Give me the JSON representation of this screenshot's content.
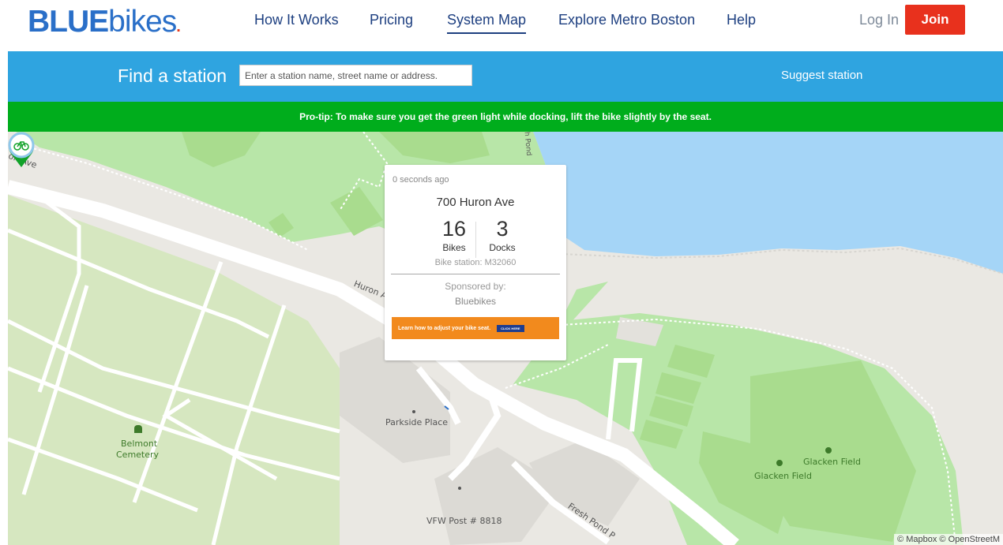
{
  "nav": {
    "logo_bold": "BLUE",
    "logo_light": "bikes",
    "logo_dot": ".",
    "links": [
      "How It Works",
      "Pricing",
      "System Map",
      "Explore Metro Boston",
      "Help"
    ],
    "active_link": "System Map",
    "login": "Log In",
    "join": "Join"
  },
  "find": {
    "title": "Find a station",
    "placeholder": "Enter a station name, street name or address.",
    "suggest": "Suggest station"
  },
  "protip": "Pro-tip: To make sure you get the green light while docking, lift the bike slightly by the seat.",
  "popup": {
    "time": "0 seconds ago",
    "station_name": "700 Huron Ave",
    "bikes_count": "16",
    "bikes_label": "Bikes",
    "docks_count": "3",
    "docks_label": "Docks",
    "station_id": "Bike station: M32060",
    "sponsored_by": "Sponsored by:",
    "sponsor": "Bluebikes",
    "banner_text": "Learn how to adjust your bike seat.",
    "banner_button": "CLICK HERE"
  },
  "map": {
    "labels": {
      "huron_ave_left": "on Ave",
      "huron_ave_mid": "Huron A",
      "fresh_pond_top": "sh Pond",
      "parkside": "Parkside Place",
      "belmont": "Belmont",
      "cemetery": "Cemetery",
      "glacken1": "Glacken Field",
      "glacken2": "Glacken Field",
      "vfw": "VFW Post # 8818",
      "fresh_pond_bottom": "Fresh Pond P"
    },
    "attribution": "© Mapbox © OpenStreetM"
  },
  "colors": {
    "brand_blue": "#2a6fc8",
    "nav_text": "#1d3f80",
    "join_red": "#e8311d",
    "find_bar": "#2fa4e0",
    "protip_green": "#00ad1c",
    "water": "#a5d5f7",
    "park": "#b8e6a8",
    "field": "#a9dc8e",
    "marker_green": "#11a229"
  },
  "icons": {
    "marker": "bike-station-marker-icon",
    "cemetery": "cemetery-icon",
    "park": "tree-icon"
  }
}
